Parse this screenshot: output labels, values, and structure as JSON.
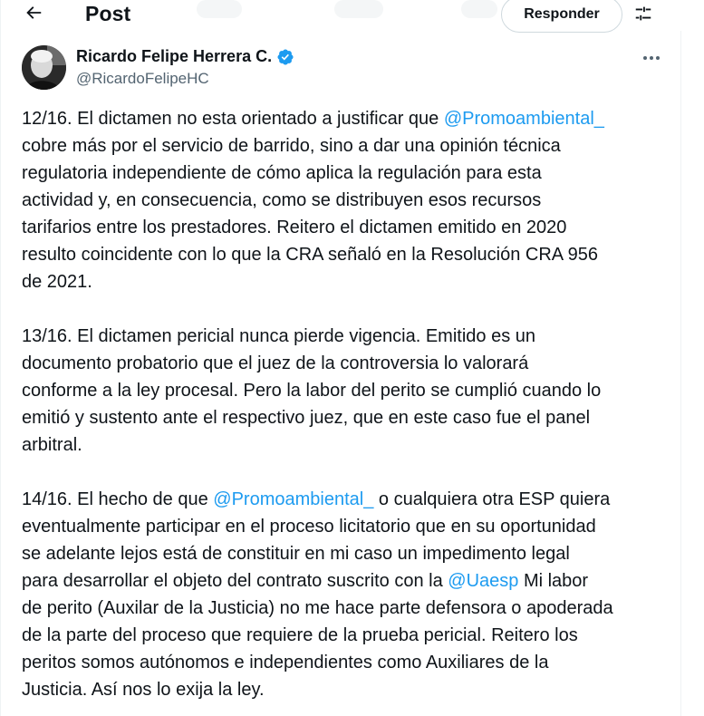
{
  "header": {
    "title": "Post",
    "back_icon": "arrow-left-icon",
    "reply_label": "Responder",
    "filter_icon": "sliders-icon"
  },
  "author": {
    "name": "Ricardo Felipe Herrera C.",
    "handle": "@RicardoFelipeHC",
    "verified_icon": "verified-badge-icon",
    "more_icon": "more-horizontal-icon"
  },
  "colors": {
    "accent": "#1d9bf0",
    "text": "#0f1419",
    "muted": "#536471"
  },
  "tweet": {
    "p1": {
      "l1_pre": "12/16. El dictamen no esta orientado a justificar que ",
      "l1_mention": "@Promoambiental_",
      "l2": "cobre más por el servicio de barrido, sino a dar una opinión técnica",
      "l3": "regulatoria independiente de cómo  aplica la regulación para esta",
      "l4": "actividad y, en consecuencia, como se distribuyen esos recursos",
      "l5": "tarifarios entre los prestadores. Reitero el dictamen emitido en 2020",
      "l6": "resulto coincidente con lo que la CRA señaló en la Resolución CRA 956",
      "l7": "de 2021."
    },
    "p2": {
      "l1": "13/16. El dictamen pericial nunca pierde vigencia. Emitido es un",
      "l2": "documento probatorio que el juez de la controversia lo valorará",
      "l3": "conforme a la ley procesal. Pero la labor del perito se cumplió cuando lo",
      "l4": "emitió y sustento ante el respectivo juez, que en este caso fue el panel",
      "l5": "arbitral."
    },
    "p3": {
      "l1_pre": "14/16. El hecho de que ",
      "l1_mention": "@Promoambiental_",
      "l1_post": " o cualquiera otra ESP quiera",
      "l2": "eventualmente participar en el proceso licitatorio que en su oportunidad",
      "l3": "se adelante lejos está de constituir en mi caso un impedimento legal",
      "l4_pre": "para desarrollar el objeto del contrato suscrito con la ",
      "l4_mention": "@Uaesp",
      "l4_post": " Mi labor",
      "l5": "de perito (Auxilar de la Justicia) no me hace parte defensora o apoderada",
      "l6": "de la parte del proceso que requiere de la prueba pericial.  Reitero los",
      "l7": "peritos somos autónomos e independientes como Auxiliares de la",
      "l8": "Justicia. Así nos lo exija la ley."
    }
  }
}
